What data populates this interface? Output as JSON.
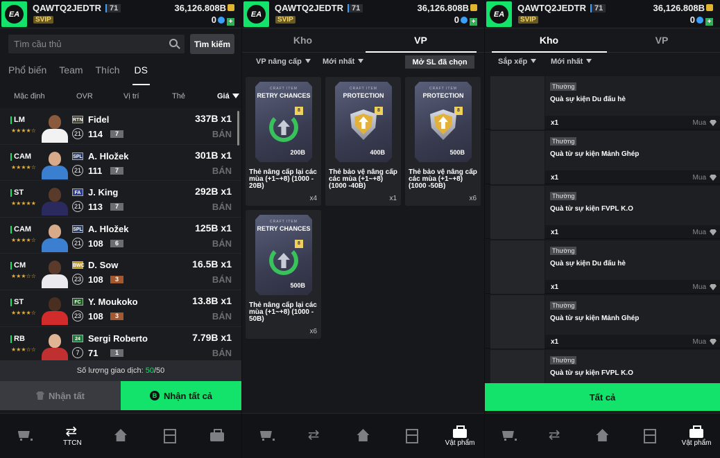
{
  "header": {
    "username": "QAWTQ2JEDTR",
    "level": "71",
    "vip": "SVIP",
    "coins": "36,126.808B",
    "gems": "0"
  },
  "panel1": {
    "search_placeholder": "Tìm cầu thủ",
    "search_button": "Tìm kiếm",
    "tabs": [
      "Phổ biến",
      "Team",
      "Thích",
      "DS"
    ],
    "active_tab": "DS",
    "columns": {
      "default": "Mặc định",
      "ovr": "OVR",
      "position": "Vị trí",
      "card": "Thẻ",
      "price": "Giá"
    },
    "players": [
      {
        "pos": "LM",
        "stars": "★★★★☆",
        "season": "RTN",
        "name": "Fidel",
        "ovr_circle": "21",
        "ovr": "114",
        "grade": "7",
        "price": "337B x1",
        "action": "BÁN"
      },
      {
        "pos": "CAM",
        "stars": "★★★★☆",
        "season": "SPL",
        "name": "A. Hložek",
        "ovr_circle": "21",
        "ovr": "111",
        "grade": "7",
        "price": "301B x1",
        "action": "BÁN"
      },
      {
        "pos": "ST",
        "stars": "★★★★★",
        "season": "FA",
        "name": "J. King",
        "ovr_circle": "21",
        "ovr": "113",
        "grade": "7",
        "price": "292B x1",
        "action": "BÁN"
      },
      {
        "pos": "CAM",
        "stars": "★★★★☆",
        "season": "SPL",
        "name": "A. Hložek",
        "ovr_circle": "21",
        "ovr": "108",
        "grade": "6",
        "price": "125B x1",
        "action": "BÁN"
      },
      {
        "pos": "CM",
        "stars": "★★★☆☆",
        "season": "BWC",
        "name": "D. Sow",
        "ovr_circle": "23",
        "ovr": "108",
        "grade": "3",
        "price": "16.5B x1",
        "action": "BÁN"
      },
      {
        "pos": "ST",
        "stars": "★★★★☆",
        "season": "FC",
        "name": "Y. Moukoko",
        "ovr_circle": "23",
        "ovr": "108",
        "grade": "3",
        "price": "13.8B x1",
        "action": "BÁN"
      },
      {
        "pos": "RB",
        "stars": "★★★☆☆",
        "season": "24",
        "name": "Sergi Roberto",
        "ovr_circle": "7",
        "ovr": "71",
        "grade": "1",
        "price": "7.79B x1",
        "action": "BÁN"
      }
    ],
    "trade_count_label": "Số lượng giao dịch:",
    "trade_used": "50",
    "trade_total": "/50",
    "receive_button": "Nhận tất",
    "receive_all_button": "Nhận tất cả"
  },
  "panel2": {
    "tabs": [
      "Kho",
      "VP"
    ],
    "active_tab": "VP",
    "filter_upgrade": "VP nâng cấp",
    "filter_newest": "Mới nhất",
    "open_selected": "Mở SL đã chọn",
    "items": [
      {
        "craft": "CRAFT ITEM",
        "pack_title": "RETRY CHANCES",
        "badge": "8",
        "value": "200B",
        "desc": "Thẻ nâng cấp lại các mùa (+1~+8) (1000 - 20B)",
        "qty": "x4",
        "kind": "retry"
      },
      {
        "craft": "CRAFT ITEM",
        "pack_title": "PROTECTION",
        "badge": "8",
        "value": "400B",
        "desc": "Thẻ bảo vệ nâng cấp các mùa (+1~+8) (1000 -40B)",
        "qty": "x1",
        "kind": "protect"
      },
      {
        "craft": "CRAFT ITEM",
        "pack_title": "PROTECTION",
        "badge": "8",
        "value": "500B",
        "desc": "Thẻ bảo vệ nâng cấp các mùa (+1~+8) (1000 -50B)",
        "qty": "x6",
        "kind": "protect"
      },
      {
        "craft": "CRAFT ITEM",
        "pack_title": "RETRY CHANCES",
        "badge": "8",
        "value": "500B",
        "desc": "Thẻ nâng cấp lại các mùa (+1~+8) (1000 - 50B)",
        "qty": "x6",
        "kind": "retry"
      }
    ]
  },
  "panel3": {
    "tabs": [
      "Kho",
      "VP"
    ],
    "active_tab": "Kho",
    "filter_sort": "Sắp xếp",
    "filter_newest": "Mới nhất",
    "rewards": [
      {
        "tag": "Thường",
        "title": "Quà sự kiện Du đấu hè",
        "qty": "x1",
        "buy": "Mua"
      },
      {
        "tag": "Thường",
        "title": "Quà từ sự kiện Mảnh Ghép",
        "qty": "x1",
        "buy": "Mua"
      },
      {
        "tag": "Thường",
        "title": "Quà từ sự kiện FVPL K.O",
        "qty": "x1",
        "buy": "Mua"
      },
      {
        "tag": "Thường",
        "title": "Quà sự kiện Du đấu hè",
        "qty": "x1",
        "buy": "Mua"
      },
      {
        "tag": "Thường",
        "title": "Quà từ sự kiện Mảnh Ghép",
        "qty": "x1",
        "buy": "Mua"
      },
      {
        "tag": "Thường",
        "title": "Quà từ sự kiện FVPL K.O",
        "qty": "x1",
        "buy": "Mua"
      }
    ],
    "all_button": "Tất cả"
  },
  "nav": {
    "ttcn": "TTCN",
    "items": "Vật phẩm"
  },
  "colors": {
    "accent": "#14e36b",
    "bg": "#17181b"
  }
}
